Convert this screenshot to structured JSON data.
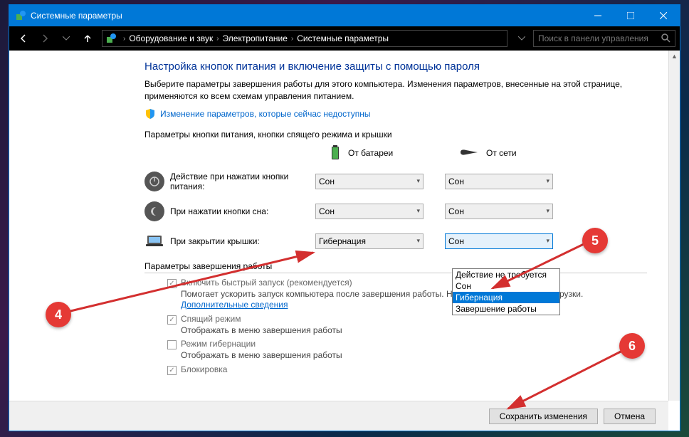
{
  "window": {
    "title": "Системные параметры"
  },
  "breadcrumb": {
    "items": [
      "Оборудование и звук",
      "Электропитание",
      "Системные параметры"
    ]
  },
  "search": {
    "placeholder": "Поиск в панели управления"
  },
  "page": {
    "heading": "Настройка кнопок питания и включение защиты с помощью пароля",
    "description": "Выберите параметры завершения работы для этого компьютера. Изменения параметров, внесенные на этой странице, применяются ко всем схемам управления питанием.",
    "shield_link": "Изменение параметров, которые сейчас недоступны",
    "section_buttons": "Параметры кнопки питания, кнопки спящего режима и крышки",
    "col_battery": "От батареи",
    "col_ac": "От сети",
    "rows": {
      "power_button": {
        "label": "Действие при нажатии кнопки питания:",
        "battery": "Сон",
        "ac": "Сон"
      },
      "sleep_button": {
        "label": "При нажатии кнопки сна:",
        "battery": "Сон",
        "ac": "Сон"
      },
      "lid_close": {
        "label": "При закрытии крышки:",
        "battery": "Гибернация",
        "ac": "Сон"
      }
    },
    "dropdown_options": [
      "Действие не требуется",
      "Сон",
      "Гибернация",
      "Завершение работы"
    ],
    "section_shutdown": "Параметры завершения работы",
    "shutdown": {
      "fast_startup": {
        "label": "Включить быстрый запуск (рекомендуется)",
        "desc": "Помогает ускорить запуск компьютера после завершения работы. Не влияет на режим перезагрузки.",
        "link": "Дополнительные сведения"
      },
      "sleep": {
        "label": "Спящий режим",
        "desc": "Отображать в меню завершения работы"
      },
      "hibernate": {
        "label": "Режим гибернации",
        "desc": "Отображать в меню завершения работы"
      },
      "lock": {
        "label": "Блокировка"
      }
    }
  },
  "buttons": {
    "save": "Сохранить изменения",
    "cancel": "Отмена"
  },
  "annotations": {
    "b4": "4",
    "b5": "5",
    "b6": "6"
  }
}
